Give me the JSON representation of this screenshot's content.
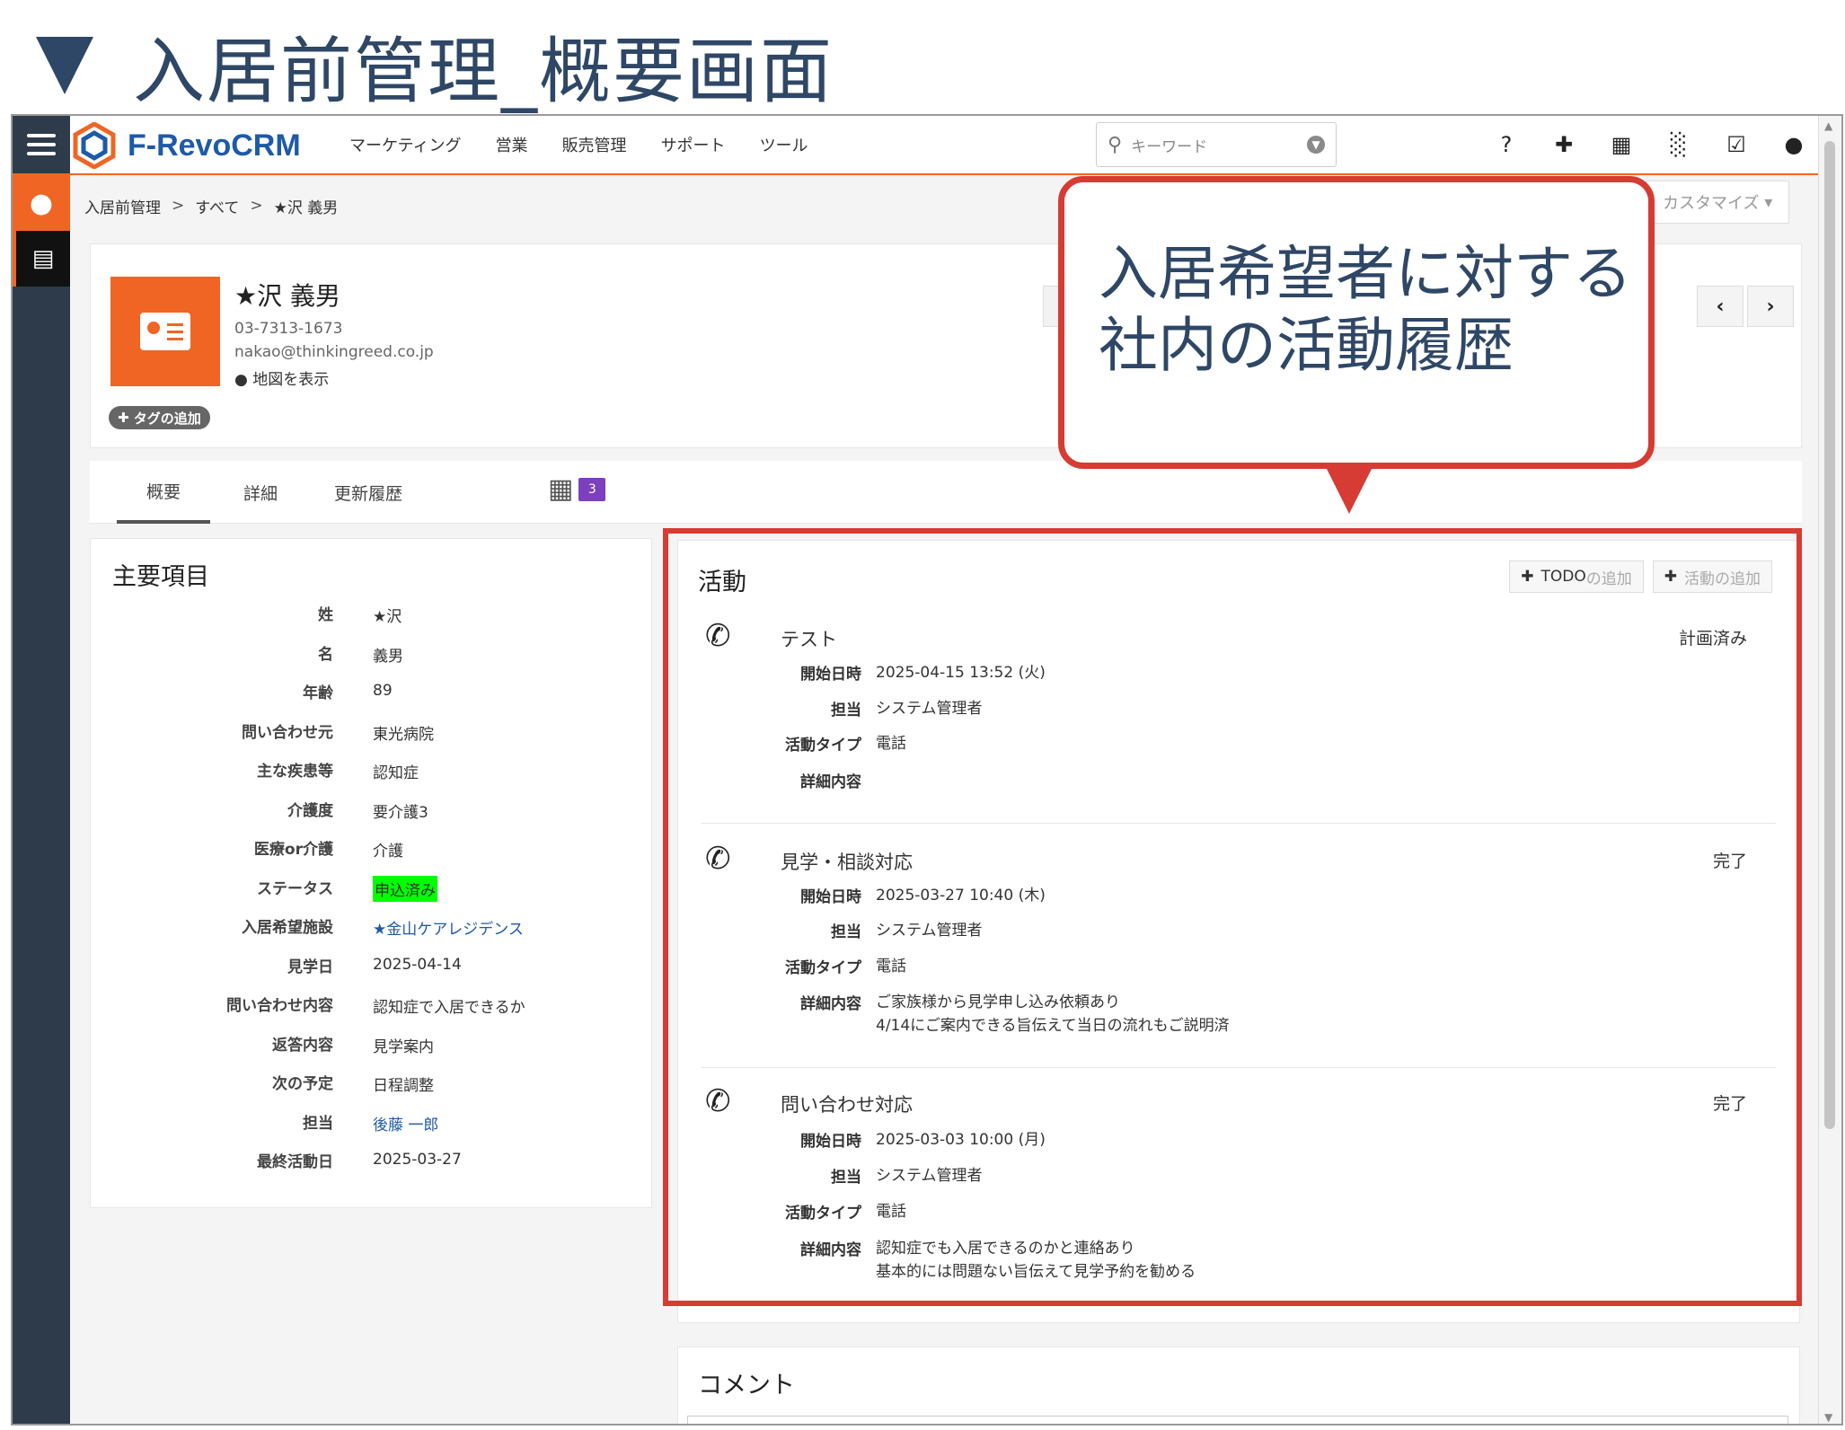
{
  "slide_title": "入居前管理_概要画面",
  "app": {
    "brand": "F-RevoCRM",
    "nav": [
      "マーケティング",
      "営業",
      "販売管理",
      "サポート",
      "ツール"
    ],
    "search_placeholder": "キーワード"
  },
  "breadcrumb": [
    "入居前管理",
    "すべて",
    "★沢 義男"
  ],
  "customize_label": "カスタマイズ",
  "record": {
    "name": "★沢 義男",
    "phone": "03-7313-1673",
    "email": "nakao@thinkingreed.co.jp",
    "map_label": "地図を表示",
    "tag_add_label": "タグの追加"
  },
  "tabs": [
    "概要",
    "詳細",
    "更新履歴"
  ],
  "calendar_badge": "3",
  "key_fields": {
    "title": "主要項目",
    "rows": [
      {
        "label": "姓",
        "value": "★沢"
      },
      {
        "label": "名",
        "value": "義男"
      },
      {
        "label": "年齢",
        "value": "89"
      },
      {
        "label": "問い合わせ元",
        "value": "東光病院"
      },
      {
        "label": "主な疾患等",
        "value": "認知症"
      },
      {
        "label": "介護度",
        "value": "要介護3"
      },
      {
        "label": "医療or介護",
        "value": "介護"
      },
      {
        "label": "ステータス",
        "value": "申込済み"
      },
      {
        "label": "入居希望施設",
        "value": "★金山ケアレジデンス"
      },
      {
        "label": "見学日",
        "value": "2025-04-14"
      },
      {
        "label": "問い合わせ内容",
        "value": "認知症で入居できるか"
      },
      {
        "label": "返答内容",
        "value": "見学案内"
      },
      {
        "label": "次の予定",
        "value": "日程調整"
      },
      {
        "label": "担当",
        "value": "後藤 一郎"
      },
      {
        "label": "最終活動日",
        "value": "2025-03-27"
      }
    ]
  },
  "activities": {
    "title": "活動",
    "add_todo_label": "TODO",
    "add_todo_suffix": "の追加",
    "add_activity_label": "活動の追加",
    "field_labels": {
      "start": "開始日時",
      "owner": "担当",
      "type": "活動タイプ",
      "detail": "詳細内容"
    },
    "items": [
      {
        "name": "テスト",
        "status": "計画済み",
        "start": "2025-04-15 13:52 (火)",
        "owner": "システム管理者",
        "type": "電話",
        "detail_1": "",
        "detail_2": ""
      },
      {
        "name": "見学・相談対応",
        "status": "完了",
        "start": "2025-03-27 10:40 (木)",
        "owner": "システム管理者",
        "type": "電話",
        "detail_1": "ご家族様から見学申し込み依頼あり",
        "detail_2": "4/14にご案内できる旨伝えて当日の流れもご説明済"
      },
      {
        "name": "問い合わせ対応",
        "status": "完了",
        "start": "2025-03-03 10:00 (月)",
        "owner": "システム管理者",
        "type": "電話",
        "detail_1": "認知症でも入居できるのかと連絡あり",
        "detail_2": "基本的には問題ない旨伝えて見学予約を勧める"
      }
    ]
  },
  "comments_title": "コメント",
  "callout": {
    "line1": "入居希望者に対する",
    "line2": "社内の活動履歴"
  },
  "colors": {
    "accent": "#f06524",
    "brand_blue": "#1e5aa8",
    "annotation_red": "#d63c33",
    "status_green": "#00ff00",
    "heading_navy": "#2f4766"
  }
}
